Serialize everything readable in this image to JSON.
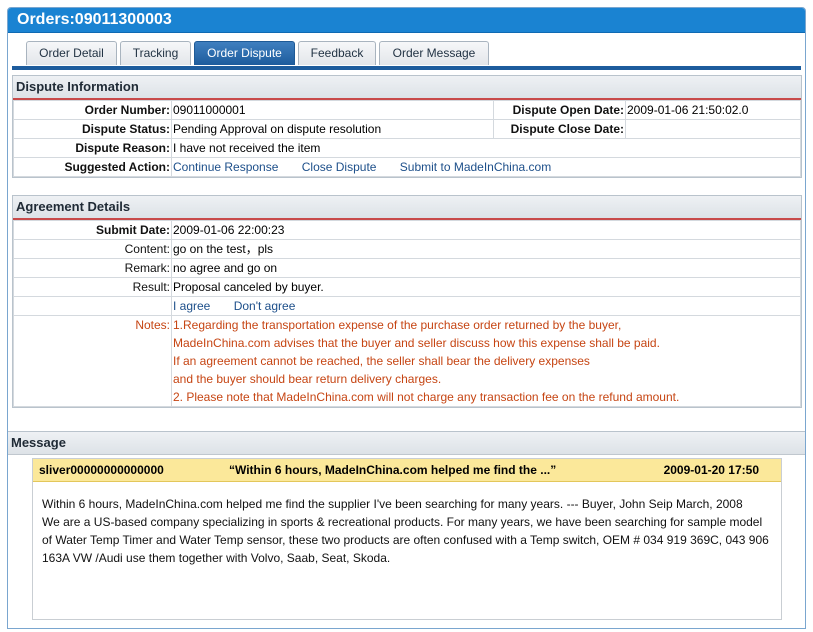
{
  "page": {
    "title": "Orders:09011300003"
  },
  "tabs": [
    {
      "label": "Order Detail"
    },
    {
      "label": "Tracking"
    },
    {
      "label": "Order Dispute"
    },
    {
      "label": "Feedback"
    },
    {
      "label": "Order Message"
    }
  ],
  "dispute": {
    "heading": "Dispute Information",
    "order_number_label": "Order Number:",
    "order_number": "09011000001",
    "open_date_label": "Dispute Open Date:",
    "open_date": "2009-01-06 21:50:02.0",
    "status_label": "Dispute Status:",
    "status": "Pending Approval on dispute resolution",
    "close_date_label": "Dispute Close Date:",
    "close_date": "",
    "reason_label": "Dispute Reason:",
    "reason": "I have not received the item",
    "action_label": "Suggested Action:",
    "actions": [
      "Continue Response",
      "Close Dispute",
      "Submit to MadeInChina.com"
    ]
  },
  "agreement": {
    "heading": "Agreement Details",
    "submit_label": "Submit Date:",
    "submit_date": "2009-01-06 22:00:23",
    "content_label": "Content:",
    "content": "go on the test，pls",
    "remark_label": "Remark:",
    "remark": "no agree and go on",
    "result_label": "Result:",
    "result": "Proposal canceled by buyer.",
    "agree_link": "I agree",
    "disagree_link": "Don't agree",
    "notes_label": "Notes:",
    "notes": [
      "1.Regarding the transportation expense of the purchase order returned by the buyer,",
      "MadeInChina.com advises that the buyer and seller discuss how this expense shall be paid.",
      "If an agreement cannot be reached, the seller shall bear the delivery expenses",
      "and the buyer should bear return delivery charges.",
      "2. Please note that MadeInChina.com will not charge any transaction fee on the refund amount."
    ]
  },
  "message": {
    "heading": "Message",
    "sender": "sliver00000000000000",
    "subject": "“Within 6 hours, MadeInChina.com helped me find the ...”",
    "date": "2009-01-20 17:50",
    "paragraph1": "Within 6 hours, MadeInChina.com helped me find the supplier I've been searching for many years.     --- Buyer, John Seip   March, 2008",
    "paragraph2": "We are a US-based company specializing in sports & recreational products. For many years, we have been searching for sample model of Water Temp Timer and Water Temp sensor, these two products are often confused with a Temp switch, OEM # 034 919 369C, 043 906 163A VW /Audi use them together with Volvo, Saab, Seat, Skoda."
  },
  "colors": {
    "title_bar": "#1a83d2",
    "active_tab": "#1d5c9d",
    "notes_text": "#c64513",
    "link": "#1d4f8a",
    "message_bar": "#fbe89a"
  }
}
